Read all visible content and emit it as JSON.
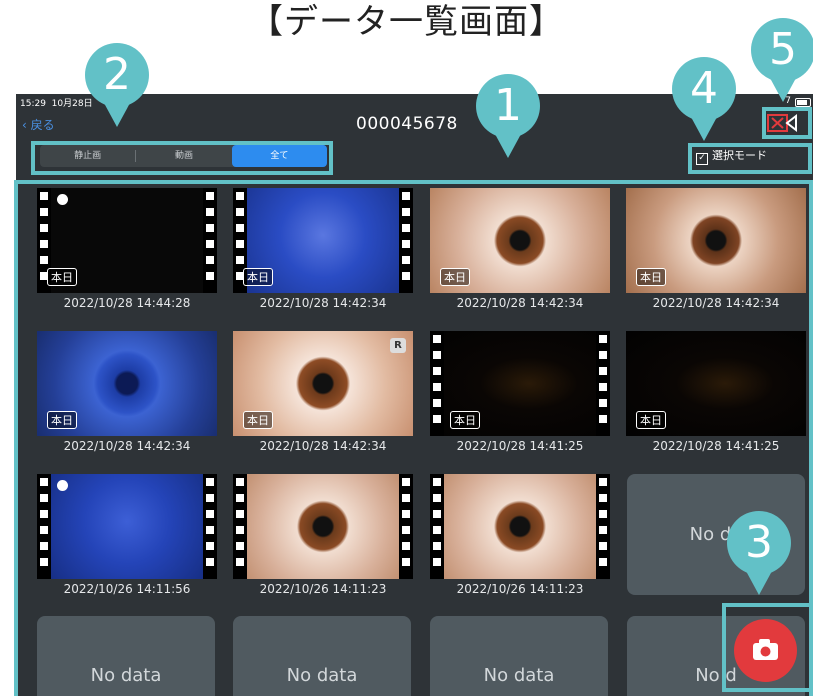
{
  "page_title": "【データ一覧画面】",
  "callouts": [
    "1",
    "2",
    "3",
    "4",
    "5"
  ],
  "statusbar": {
    "time": "15:29",
    "date": "10月28日",
    "battery": "7"
  },
  "header": {
    "back_label": "戻る",
    "patient_id": "000045678"
  },
  "filter": {
    "still_label": "静止画",
    "video_label": "動画",
    "all_label": "全て",
    "selected": "全て"
  },
  "select_mode": {
    "label": "選択モード",
    "checked": true
  },
  "today_badge": "本日",
  "r_badge": "R",
  "empty_label": "No data",
  "no_data_partial_a": "No da",
  "no_data_partial_b": "No d",
  "items": [
    {
      "date": "2022/10/28 14:44:28",
      "kind": "video"
    },
    {
      "date": "2022/10/28 14:42:34",
      "kind": "video"
    },
    {
      "date": "2022/10/28 14:42:34",
      "kind": "photo"
    },
    {
      "date": "2022/10/28 14:42:34",
      "kind": "photo"
    },
    {
      "date": "2022/10/28 14:42:34",
      "kind": "photo"
    },
    {
      "date": "2022/10/28 14:42:34",
      "kind": "photo"
    },
    {
      "date": "2022/10/28 14:41:25",
      "kind": "video"
    },
    {
      "date": "2022/10/28 14:41:25",
      "kind": "photo"
    },
    {
      "date": "2022/10/26 14:11:56",
      "kind": "video"
    },
    {
      "date": "2022/10/26 14:11:23",
      "kind": "video"
    },
    {
      "date": "2022/10/26 14:11:23",
      "kind": "video"
    }
  ],
  "colors": {
    "accent": "#62c1c7",
    "background": "#2e3337",
    "segment_active": "#2d8cef",
    "record_button": "#e23a3d"
  }
}
